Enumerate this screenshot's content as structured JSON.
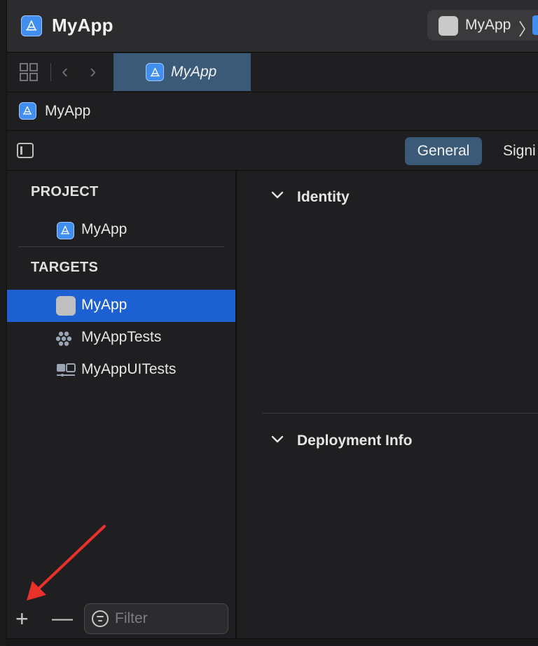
{
  "window": {
    "title": "MyApp",
    "scheme_target": "MyApp",
    "scheme_separator": "〉"
  },
  "tabbar": {
    "active_tab": "MyApp"
  },
  "jumpbar": {
    "item": "MyApp"
  },
  "editor_tabs": {
    "general": "General",
    "signing": "Signi"
  },
  "sidebar": {
    "project_header": "PROJECT",
    "project_item": "MyApp",
    "targets_header": "TARGETS",
    "targets": [
      {
        "label": "MyApp",
        "icon": "app-target-icon",
        "selected": true
      },
      {
        "label": "MyAppTests",
        "icon": "unit-tests-icon",
        "selected": false
      },
      {
        "label": "MyAppUITests",
        "icon": "ui-tests-icon",
        "selected": false
      }
    ],
    "add_label": "+",
    "remove_label": "—",
    "filter_placeholder": "Filter"
  },
  "content": {
    "sections": [
      {
        "title": "Identity",
        "expanded": true
      },
      {
        "title": "Deployment Info",
        "expanded": true
      }
    ]
  },
  "colors": {
    "selection": "#1c60d2",
    "active_tab": "#3a5a78",
    "annotation_arrow": "#e8312a"
  }
}
